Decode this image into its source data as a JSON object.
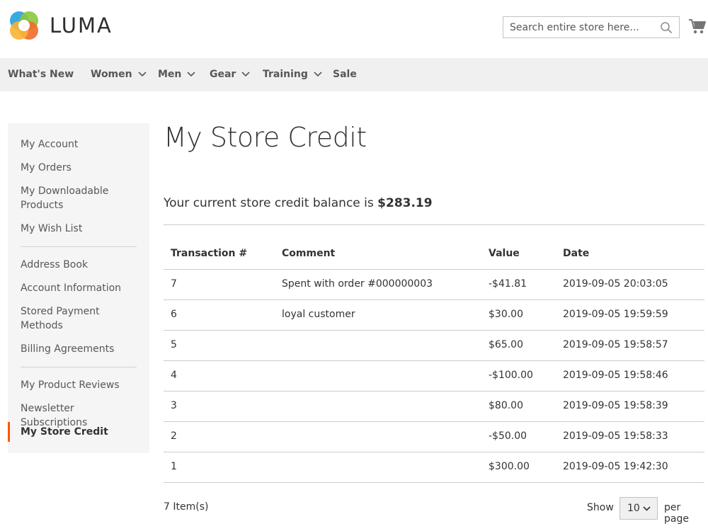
{
  "header": {
    "logo_text": "LUMA",
    "search_placeholder": "Search entire store here..."
  },
  "nav": {
    "items": [
      {
        "label": "What's New",
        "has_dropdown": false
      },
      {
        "label": "Women",
        "has_dropdown": true
      },
      {
        "label": "Men",
        "has_dropdown": true
      },
      {
        "label": "Gear",
        "has_dropdown": true
      },
      {
        "label": "Training",
        "has_dropdown": true
      },
      {
        "label": "Sale",
        "has_dropdown": false
      }
    ]
  },
  "sidebar": {
    "items": [
      {
        "label": "My Account"
      },
      {
        "label": "My Orders"
      },
      {
        "label": "My Downloadable Products"
      },
      {
        "label": "My Wish List"
      },
      {
        "label": "Address Book"
      },
      {
        "label": "Account Information"
      },
      {
        "label": "Stored Payment Methods"
      },
      {
        "label": "Billing Agreements"
      },
      {
        "label": "My Product Reviews"
      },
      {
        "label": "Newsletter Subscriptions"
      },
      {
        "label": "My Store Credit",
        "active": true
      }
    ]
  },
  "main": {
    "title": "My Store Credit",
    "balance_prefix": "Your current store credit balance is ",
    "balance_amount": "$283.19",
    "table": {
      "headers": [
        "Transaction #",
        "Comment",
        "Value",
        "Date"
      ],
      "rows": [
        {
          "id": "7",
          "comment": "Spent with order #000000003",
          "value": "-$41.81",
          "date": "2019-09-05 20:03:05"
        },
        {
          "id": "6",
          "comment": "loyal customer",
          "value": "$30.00",
          "date": "2019-09-05 19:59:59"
        },
        {
          "id": "5",
          "comment": "",
          "value": "$65.00",
          "date": "2019-09-05 19:58:57"
        },
        {
          "id": "4",
          "comment": "",
          "value": "-$100.00",
          "date": "2019-09-05 19:58:46"
        },
        {
          "id": "3",
          "comment": "",
          "value": "$80.00",
          "date": "2019-09-05 19:58:39"
        },
        {
          "id": "2",
          "comment": "",
          "value": "-$50.00",
          "date": "2019-09-05 19:58:33"
        },
        {
          "id": "1",
          "comment": "",
          "value": "$300.00",
          "date": "2019-09-05 19:42:30"
        }
      ]
    },
    "footer": {
      "item_count": "7 Item(s)",
      "show_label": "Show",
      "per_page_value": "10",
      "per_page_label": "per page"
    }
  },
  "colors": {
    "active_accent": "#ff5501",
    "nav_bg": "#f0f0f0",
    "sidebar_bg": "#f5f5f5"
  }
}
